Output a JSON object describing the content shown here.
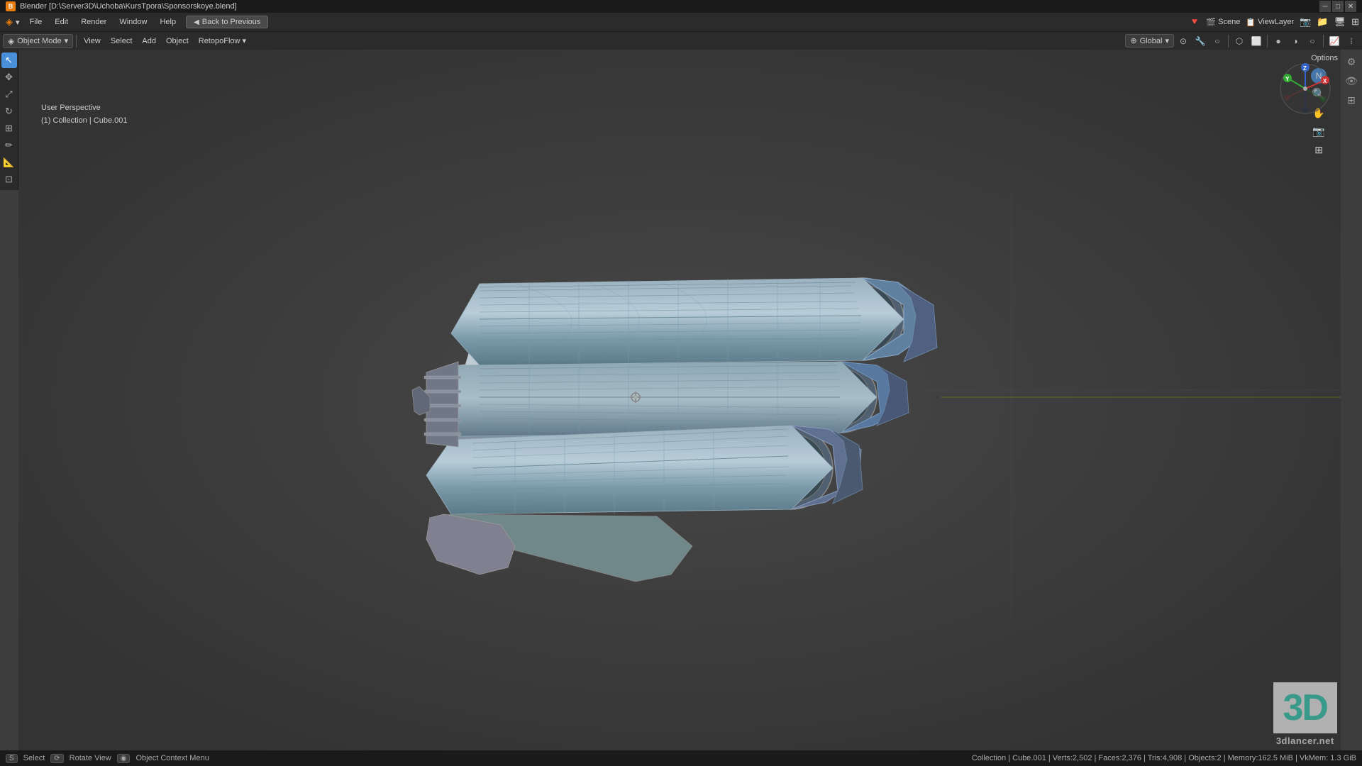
{
  "titlebar": {
    "title": "Blender [D:\\Server3D\\Uchoba\\KursTpora\\Sponsorskoye.blend]",
    "icon": "B"
  },
  "window_controls": {
    "minimize": "─",
    "maximize": "□",
    "close": "✕"
  },
  "menubar": {
    "items": [
      "File",
      "Edit",
      "Render",
      "Window",
      "Help"
    ],
    "back_button": "Back to Previous"
  },
  "viewport_toolbar": {
    "mode_dropdown": "Object Mode",
    "items": [
      "View",
      "Select",
      "Add",
      "Object",
      "RetopoFlow"
    ],
    "global_label": "Global",
    "dropdown_arrow": "▾"
  },
  "left_toolbar": {
    "tools": [
      "↖",
      "✥",
      "↔",
      "↻",
      "⊡",
      "✏",
      "🔧",
      "📐",
      "⚙"
    ]
  },
  "viewport_info": {
    "view": "User Perspective",
    "collection": "(1) Collection | Cube.001"
  },
  "options_label": "Options",
  "status_bar": {
    "key1": "S",
    "label1": "Select",
    "key2": "⟳",
    "label2": "Rotate View",
    "key3": "◉",
    "label3": "Object Context Menu",
    "right_info": "Collection | Cube.001 | Verts:2,502 | Faces:2,376 | Tris:4,908 | Objects:2 | Memory:162.5 MiB | VkMem: 1.3 GiB"
  },
  "watermark": {
    "big_text": "3D",
    "url_text": "3dlancer.net"
  },
  "top_right": {
    "render_icon": "🔺",
    "scene_label": "Scene",
    "layer_label": "ViewLayer",
    "icons": [
      "🎬",
      "📁",
      "📦",
      "🔲"
    ]
  },
  "gizmo": {
    "x_color": "#cc3333",
    "y_color": "#33aa33",
    "z_color": "#3366cc"
  }
}
